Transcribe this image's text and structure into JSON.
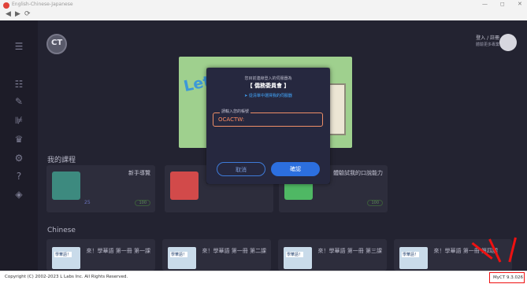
{
  "window": {
    "title": "English-Chinese-Japanese",
    "controls": [
      "—",
      "◻",
      "✕"
    ],
    "nav": [
      "◀",
      "▶",
      "⟳"
    ]
  },
  "header": {
    "login_label": "登入 / 註冊",
    "login_sub": "體驗更多專業"
  },
  "banner": {
    "word": "Let's"
  },
  "sidebar": {
    "icons": [
      "menu-icon",
      "course-icon",
      "edit-icon",
      "book-icon",
      "crown-icon",
      "settings-icon",
      "help-icon",
      "tag-icon"
    ]
  },
  "sections": {
    "my_courses": "我的課程",
    "chinese": "Chinese"
  },
  "my_courses": [
    {
      "name": "新手導覽",
      "footer": "25",
      "badge": "100",
      "thumb_color": "#3d8a7f"
    },
    {
      "name": "",
      "footer": "",
      "badge": "",
      "thumb_color": "#d24a4a"
    },
    {
      "name": "體驗試我的口說能力",
      "footer": "",
      "badge": "100",
      "thumb_color": "#4fb864"
    }
  ],
  "chinese_courses": [
    {
      "title": "來！學華語 第一冊 第一課",
      "thumb": "學華語！"
    },
    {
      "title": "來！學華語 第一冊 第二課",
      "thumb": "學華語！"
    },
    {
      "title": "來！學華語 第一冊 第三課",
      "thumb": "學華語！"
    },
    {
      "title": "來！學華語 第一冊 第四課",
      "thumb": "學華語！"
    }
  ],
  "modal": {
    "hint": "您目前連線登入的伺服器為",
    "server_title": "【 僑務委員會 】",
    "link": "➤ 從清單中選擇我的伺服器",
    "field_label": "請輸入您的帳號",
    "field_value": "OCACTW:",
    "cancel_label": "取消",
    "ok_label": "確認"
  },
  "status": {
    "copyright": "Copyright (C) 2002-2023 L Labs Inc. All Rights Reserved.",
    "version": "MyCT 9.3.026"
  },
  "colors": {
    "app_bg": "#232331",
    "accent": "#2c6fdf",
    "field_accent": "#ff8d62",
    "annotation": "#ee1111"
  }
}
